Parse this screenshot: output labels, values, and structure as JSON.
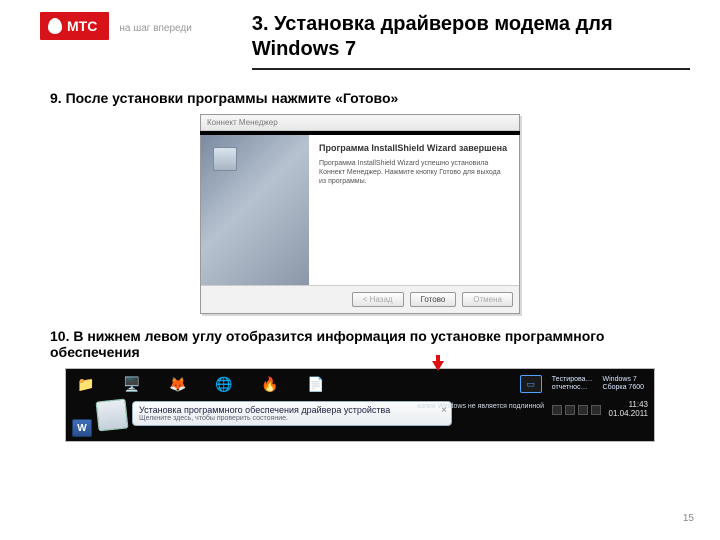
{
  "brand": {
    "name": "МТС",
    "slogan": "на шаг впереди"
  },
  "title": "3. Установка драйверов модема для Windows 7",
  "step9": "9. После установки программы нажмите «Готово»",
  "step10": "10. В нижнем левом углу отобразится информация по установке программного обеспечения",
  "wizard": {
    "titlebar": "Коннект Менеджер",
    "heading": "Программа InstallShield Wizard завершена",
    "body": "Программа InstallShield Wizard успешно установила Коннект Менеджер. Нажмите кнопку Готово для выхода из программы.",
    "back": "< Назад",
    "finish": "Готово",
    "cancel": "Отмена"
  },
  "balloon": {
    "title": "Установка программного обеспечения драйвера устройства",
    "sub": "Щелкните здесь, чтобы проверить состояние.",
    "close": "×"
  },
  "tray": {
    "test_label": "Тестирова…",
    "report_label": "отчетнос…",
    "win_line1": "Windows 7",
    "win_line2": "Сборка 7600",
    "not_genuine": "копия Windows не является подлинной",
    "time": "11:43",
    "date": "01.04.2011"
  },
  "wordmark": "W",
  "page": "15"
}
